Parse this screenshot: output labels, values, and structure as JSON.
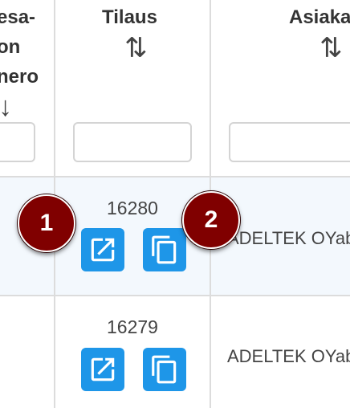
{
  "columns": {
    "ref": {
      "label_lines": [
        "esa-",
        "on",
        "nero"
      ],
      "sort_glyph": "↓"
    },
    "order": {
      "label": "Tilaus",
      "sort_glyph": "⇅"
    },
    "customer": {
      "label": "Asiaka",
      "sort_glyph": "⇅"
    }
  },
  "filters": {
    "ref": "",
    "order": "",
    "customer": ""
  },
  "rows": [
    {
      "order_number": "16280",
      "customer": "ADELTEK OYab",
      "badges": [
        "1",
        "2"
      ]
    },
    {
      "order_number": "16279",
      "customer": "ADELTEK OYab"
    }
  ],
  "icons": {
    "open": "open-in-new-icon",
    "copy": "copy-icon"
  },
  "colors": {
    "button": "#1e96e8",
    "badge": "#800000",
    "row_highlight": "#f3f8fd"
  }
}
